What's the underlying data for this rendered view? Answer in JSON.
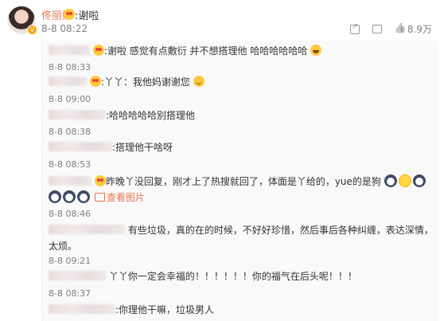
{
  "post": {
    "username": "佟丽娅",
    "reply_text": ":谢啦",
    "time": "8-8 08:22",
    "actions": {
      "like_count": "8.9万"
    }
  },
  "thread": [
    {
      "text": ":谢啦 感觉有点敷衍 并不想搭理他 哈哈哈哈哈哈",
      "time": "8-8 08:33"
    },
    {
      "text": ":丫丫：我他妈谢谢您",
      "time": "8-8 09:00"
    },
    {
      "text": ":哈哈哈哈哈别搭理他",
      "time": "8-8 08:38"
    },
    {
      "text": ":搭理他干啥呀",
      "time": "8-8 08:53"
    },
    {
      "text": "昨晚丫没回复，刚才上了热搜就回了，体面是丫给的，yue的是狗",
      "link": "查看图片",
      "time": "8-8 08:46"
    },
    {
      "text": "有些垃圾，真的在的时候，不好好珍惜，然后事后各种纠缠，表达深情，",
      "text2": "太烦。",
      "time": "8-8 09:21"
    },
    {
      "text": "丫丫你一定会幸福的！！！！！！你的福气在后头呢！！！",
      "time": "8-8 08:37"
    },
    {
      "text": ":你理他干嘛，垃圾男人"
    }
  ],
  "icons": {
    "share": "share-icon",
    "comment": "comment-icon",
    "like": "like-icon"
  },
  "colors": {
    "accent": "#eb7350",
    "meta": "#808080",
    "thread_bg": "#f9f9f9"
  }
}
